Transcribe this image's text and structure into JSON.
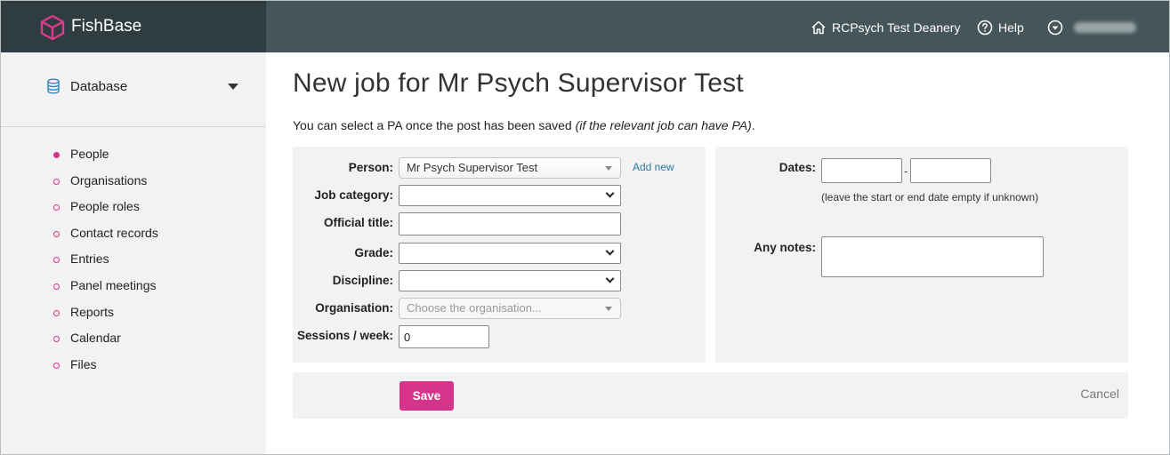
{
  "app": {
    "name": "FishBase"
  },
  "header": {
    "deanery": "RCPsych Test Deanery",
    "help": "Help",
    "user_name": "",
    "icons": {
      "logo": "cube-logo-icon",
      "deanery": "home-icon",
      "help": "help-circle-icon",
      "user": "chevron-circle-down-icon"
    }
  },
  "sidebar": {
    "section": "Database",
    "items": [
      {
        "label": "People",
        "active": true
      },
      {
        "label": "Organisations"
      },
      {
        "label": "People roles"
      },
      {
        "label": "Contact records"
      },
      {
        "label": "Entries"
      },
      {
        "label": "Panel meetings"
      },
      {
        "label": "Reports"
      },
      {
        "label": "Calendar"
      },
      {
        "label": "Files"
      }
    ]
  },
  "page": {
    "title": "New job for Mr Psych Supervisor Test",
    "intro": "You can select a PA once the post has been saved ",
    "intro_em": "(if the relevant job can have PA)",
    "intro_end": "."
  },
  "form": {
    "person": {
      "label": "Person:",
      "value": "Mr Psych Supervisor Test",
      "add_new": "Add new"
    },
    "job_category": {
      "label": "Job category:",
      "value": ""
    },
    "official_title": {
      "label": "Official title:",
      "value": ""
    },
    "grade": {
      "label": "Grade:",
      "value": ""
    },
    "discipline": {
      "label": "Discipline:",
      "value": ""
    },
    "organisation": {
      "label": "Organisation:",
      "placeholder": "Choose the organisation..."
    },
    "sessions": {
      "label": "Sessions / week:",
      "value": "0"
    },
    "dates": {
      "label": "Dates:",
      "separator": "-",
      "start": "",
      "end": "",
      "hint": "(leave the start or end date empty if unknown)"
    },
    "notes": {
      "label": "Any notes:",
      "value": ""
    }
  },
  "actions": {
    "save": "Save",
    "cancel": "Cancel"
  },
  "colors": {
    "header_bg": "#46555a",
    "brand_bg": "#2f3d40",
    "accent": "#d6338a",
    "link": "#2b7c9e"
  }
}
